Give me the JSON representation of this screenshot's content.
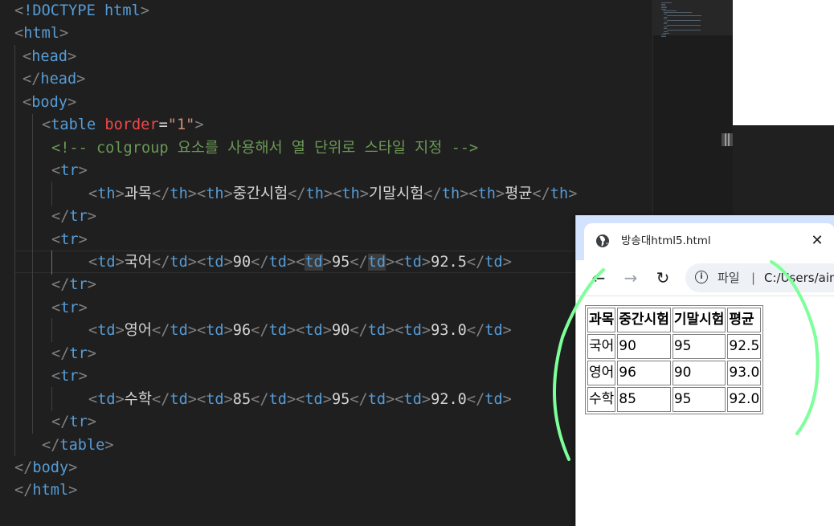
{
  "editor": {
    "lines": [
      [
        [
          "bracket",
          "<"
        ],
        [
          "doctype",
          "!DOCTYPE"
        ],
        [
          "text",
          " "
        ],
        [
          "tag",
          "html"
        ],
        [
          "bracket",
          ">"
        ]
      ],
      [
        [
          "bracket",
          "<"
        ],
        [
          "tag",
          "html"
        ],
        [
          "bracket",
          ">"
        ]
      ],
      [
        [
          "bracket",
          "<"
        ],
        [
          "tag",
          "head"
        ],
        [
          "bracket",
          ">"
        ]
      ],
      [
        [
          "bracket",
          "</"
        ],
        [
          "tag",
          "head"
        ],
        [
          "bracket",
          ">"
        ]
      ],
      [
        [
          "bracket",
          "<"
        ],
        [
          "tag",
          "body"
        ],
        [
          "bracket",
          ">"
        ]
      ],
      [
        [
          "bracket",
          "<"
        ],
        [
          "tag",
          "table"
        ],
        [
          "text",
          " "
        ],
        [
          "attr",
          "border"
        ],
        [
          "eq",
          "="
        ],
        [
          "str",
          "\"1\""
        ],
        [
          "bracket",
          ">"
        ]
      ],
      [
        [
          "comment",
          "<!-- colgroup 요소를 사용해서 열 단위로 스타일 지정 -->"
        ]
      ],
      [
        [
          "bracket",
          "<"
        ],
        [
          "tag",
          "tr"
        ],
        [
          "bracket",
          ">"
        ]
      ],
      [
        [
          "bracket",
          "<"
        ],
        [
          "tag",
          "th"
        ],
        [
          "bracket",
          ">"
        ],
        [
          "text",
          "과목"
        ],
        [
          "bracket",
          "</"
        ],
        [
          "tag",
          "th"
        ],
        [
          "bracket",
          "><"
        ],
        [
          "tag",
          "th"
        ],
        [
          "bracket",
          ">"
        ],
        [
          "text",
          "중간시험"
        ],
        [
          "bracket",
          "</"
        ],
        [
          "tag",
          "th"
        ],
        [
          "bracket",
          "><"
        ],
        [
          "tag",
          "th"
        ],
        [
          "bracket",
          ">"
        ],
        [
          "text",
          "기말시험"
        ],
        [
          "bracket",
          "</"
        ],
        [
          "tag",
          "th"
        ],
        [
          "bracket",
          "><"
        ],
        [
          "tag",
          "th"
        ],
        [
          "bracket",
          ">"
        ],
        [
          "text",
          "평균"
        ],
        [
          "bracket",
          "</"
        ],
        [
          "tag",
          "th"
        ],
        [
          "bracket",
          ">"
        ]
      ],
      [
        [
          "bracket",
          "</"
        ],
        [
          "tag",
          "tr"
        ],
        [
          "bracket",
          ">"
        ]
      ],
      [
        [
          "bracket",
          "<"
        ],
        [
          "tag",
          "tr"
        ],
        [
          "bracket",
          ">"
        ]
      ],
      [
        [
          "bracket",
          "<"
        ],
        [
          "tag",
          "td"
        ],
        [
          "bracket",
          ">"
        ],
        [
          "text",
          "국어"
        ],
        [
          "bracket",
          "</"
        ],
        [
          "tag",
          "td"
        ],
        [
          "bracket",
          "><"
        ],
        [
          "tag",
          "td"
        ],
        [
          "bracket",
          ">"
        ],
        [
          "text",
          "90"
        ],
        [
          "bracket",
          "</"
        ],
        [
          "tag",
          "td"
        ],
        [
          "bracket",
          ">"
        ],
        [
          "bracket",
          "<"
        ],
        [
          "taghl",
          "td"
        ],
        [
          "bracket",
          ">"
        ],
        [
          "text",
          "95"
        ],
        [
          "bracket",
          "</"
        ],
        [
          "taghl",
          "td"
        ],
        [
          "bracket",
          ">"
        ],
        [
          "bracket",
          "<"
        ],
        [
          "tag",
          "td"
        ],
        [
          "bracket",
          ">"
        ],
        [
          "text",
          "92.5"
        ],
        [
          "bracket",
          "</"
        ],
        [
          "tag",
          "td"
        ],
        [
          "bracket",
          ">"
        ]
      ],
      [
        [
          "bracket",
          "</"
        ],
        [
          "tag",
          "tr"
        ],
        [
          "bracket",
          ">"
        ]
      ],
      [
        [
          "bracket",
          "<"
        ],
        [
          "tag",
          "tr"
        ],
        [
          "bracket",
          ">"
        ]
      ],
      [
        [
          "bracket",
          "<"
        ],
        [
          "tag",
          "td"
        ],
        [
          "bracket",
          ">"
        ],
        [
          "text",
          "영어"
        ],
        [
          "bracket",
          "</"
        ],
        [
          "tag",
          "td"
        ],
        [
          "bracket",
          "><"
        ],
        [
          "tag",
          "td"
        ],
        [
          "bracket",
          ">"
        ],
        [
          "text",
          "96"
        ],
        [
          "bracket",
          "</"
        ],
        [
          "tag",
          "td"
        ],
        [
          "bracket",
          "><"
        ],
        [
          "tag",
          "td"
        ],
        [
          "bracket",
          ">"
        ],
        [
          "text",
          "90"
        ],
        [
          "bracket",
          "</"
        ],
        [
          "tag",
          "td"
        ],
        [
          "bracket",
          "><"
        ],
        [
          "tag",
          "td"
        ],
        [
          "bracket",
          ">"
        ],
        [
          "text",
          "93.0"
        ],
        [
          "bracket",
          "</"
        ],
        [
          "tag",
          "td"
        ],
        [
          "bracket",
          ">"
        ]
      ],
      [
        [
          "bracket",
          "</"
        ],
        [
          "tag",
          "tr"
        ],
        [
          "bracket",
          ">"
        ]
      ],
      [
        [
          "bracket",
          "<"
        ],
        [
          "tag",
          "tr"
        ],
        [
          "bracket",
          ">"
        ]
      ],
      [
        [
          "bracket",
          "<"
        ],
        [
          "tag",
          "td"
        ],
        [
          "bracket",
          ">"
        ],
        [
          "text",
          "수학"
        ],
        [
          "bracket",
          "</"
        ],
        [
          "tag",
          "td"
        ],
        [
          "bracket",
          "><"
        ],
        [
          "tag",
          "td"
        ],
        [
          "bracket",
          ">"
        ],
        [
          "text",
          "85"
        ],
        [
          "bracket",
          "</"
        ],
        [
          "tag",
          "td"
        ],
        [
          "bracket",
          "><"
        ],
        [
          "tag",
          "td"
        ],
        [
          "bracket",
          ">"
        ],
        [
          "text",
          "95"
        ],
        [
          "bracket",
          "</"
        ],
        [
          "tag",
          "td"
        ],
        [
          "bracket",
          "><"
        ],
        [
          "tag",
          "td"
        ],
        [
          "bracket",
          ">"
        ],
        [
          "text",
          "92.0"
        ],
        [
          "bracket",
          "</"
        ],
        [
          "tag",
          "td"
        ],
        [
          "bracket",
          ">"
        ]
      ],
      [
        [
          "bracket",
          "</"
        ],
        [
          "tag",
          "tr"
        ],
        [
          "bracket",
          ">"
        ]
      ],
      [
        [
          "bracket",
          "</"
        ],
        [
          "tag",
          "table"
        ],
        [
          "bracket",
          ">"
        ]
      ],
      [
        [
          "bracket",
          "</"
        ],
        [
          "tag",
          "body"
        ],
        [
          "bracket",
          ">"
        ]
      ],
      [
        [
          "bracket",
          "</"
        ],
        [
          "tag",
          "html"
        ],
        [
          "bracket",
          ">"
        ]
      ]
    ]
  },
  "browser": {
    "tab_title": "방송대html5.html",
    "tab_icon": "globe-icon",
    "close_glyph": "✕",
    "back_glyph": "←",
    "forward_glyph": "→",
    "reload_glyph": "↻",
    "info_glyph": "i",
    "omnibox_label": "파일",
    "omnibox_separator": "|",
    "omnibox_url": "C:/Users/aim"
  },
  "table": {
    "headers": [
      "과목",
      "중간시험",
      "기말시험",
      "평균"
    ],
    "rows": [
      [
        "국어",
        "90",
        "95",
        "92.5"
      ],
      [
        "영어",
        "96",
        "90",
        "93.0"
      ],
      [
        "수학",
        "85",
        "95",
        "92.0"
      ]
    ]
  },
  "colors": {
    "editor_bg": "#1f1f1f",
    "tag": "#569cd6",
    "attr": "#f44747",
    "string": "#ce9178",
    "comment": "#6a9955",
    "browser_tabstrip": "#d3e3fd",
    "scribble": "#7dff9a"
  }
}
